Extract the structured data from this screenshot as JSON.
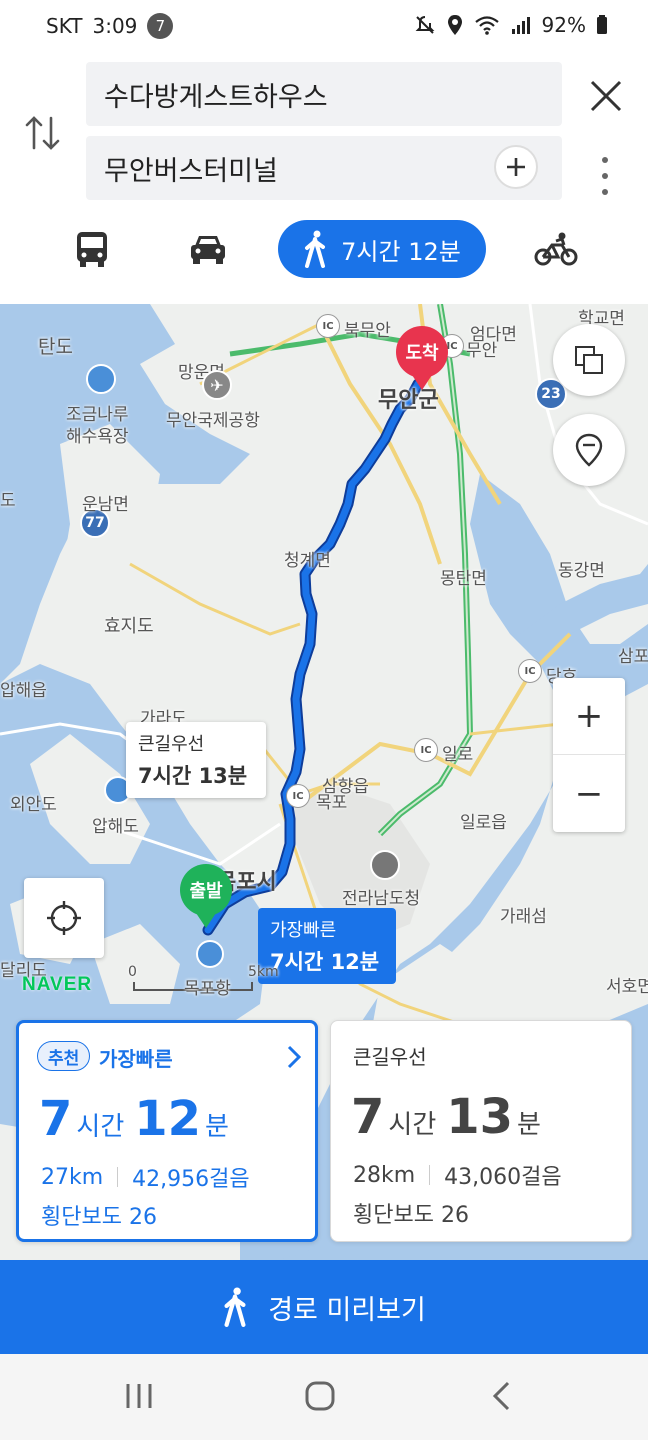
{
  "status_bar": {
    "carrier": "SKT",
    "time": "3:09",
    "notification_count": "7",
    "battery": "92%"
  },
  "route_search": {
    "origin": "수다방게스트하우스",
    "destination": "무안버스터미널"
  },
  "transport_modes": {
    "selected": "walk",
    "walk_duration": "7시간 12분"
  },
  "map": {
    "place_labels": {
      "tando": "탄도",
      "jogeumnaru": "조금나루",
      "haesuyokjang": "해수욕장",
      "mangun": "망운면",
      "airport": "무안국제공항",
      "unnam": "운남면",
      "hyojido": "효지도",
      "aphaeeup": "압해읍",
      "garado": "가라도",
      "oeando": "외안도",
      "aphaedo": "압해도",
      "bukmuan": "북무안",
      "muan_ic": "무안",
      "eonda": "엄다면",
      "hakgyo": "학교면",
      "muangun": "무안군",
      "cheonggye": "청계면",
      "mongtan": "몽탄면",
      "donggang": "동강면",
      "dangho": "당호",
      "sampo": "삼포",
      "il_ro": "일로",
      "samhyang": "삼향읍",
      "mokpo_ic": "목포",
      "illoeup": "일로읍",
      "jeonnam_office": "전라남도청",
      "garaeseom": "가래섬",
      "mokpo_city": "목포시",
      "mokpo_port": "목포항",
      "seoho": "서호면",
      "dalido": "달리도",
      "do_left": "도"
    },
    "ic_label": "IC",
    "road_numbers": {
      "r77": "77",
      "r23": "23"
    },
    "destination_marker": "도착",
    "origin_marker": "출발",
    "bubble_main_road": {
      "title": "큰길우선",
      "time": "7시간 13분"
    },
    "bubble_fastest": {
      "title": "가장빠른",
      "time": "7시간 12분"
    },
    "scale": {
      "zero": "0",
      "label": "5km"
    },
    "naver_logo": "NAVER",
    "zoom_in": "+",
    "zoom_out": "−"
  },
  "route_cards": [
    {
      "badge": "추천",
      "title": "가장빠른",
      "hours": "7",
      "hours_unit": "시간",
      "minutes": "12",
      "minutes_unit": "분",
      "distance": "27km",
      "steps": "42,956걸음",
      "crosswalks": "횡단보도 26"
    },
    {
      "title": "큰길우선",
      "hours": "7",
      "hours_unit": "시간",
      "minutes": "13",
      "minutes_unit": "분",
      "distance": "28km",
      "steps": "43,060걸음",
      "crosswalks": "횡단보도 26"
    }
  ],
  "preview_button": {
    "label": "경로 미리보기"
  },
  "colors": {
    "accent": "#1a73e8",
    "destination_pin": "#e8344e",
    "origin_pin": "#1fb25a",
    "route_line": "#1a5fd6",
    "water": "#a9c9ea",
    "land": "#eef0ee",
    "naver_green": "#03c75a"
  }
}
